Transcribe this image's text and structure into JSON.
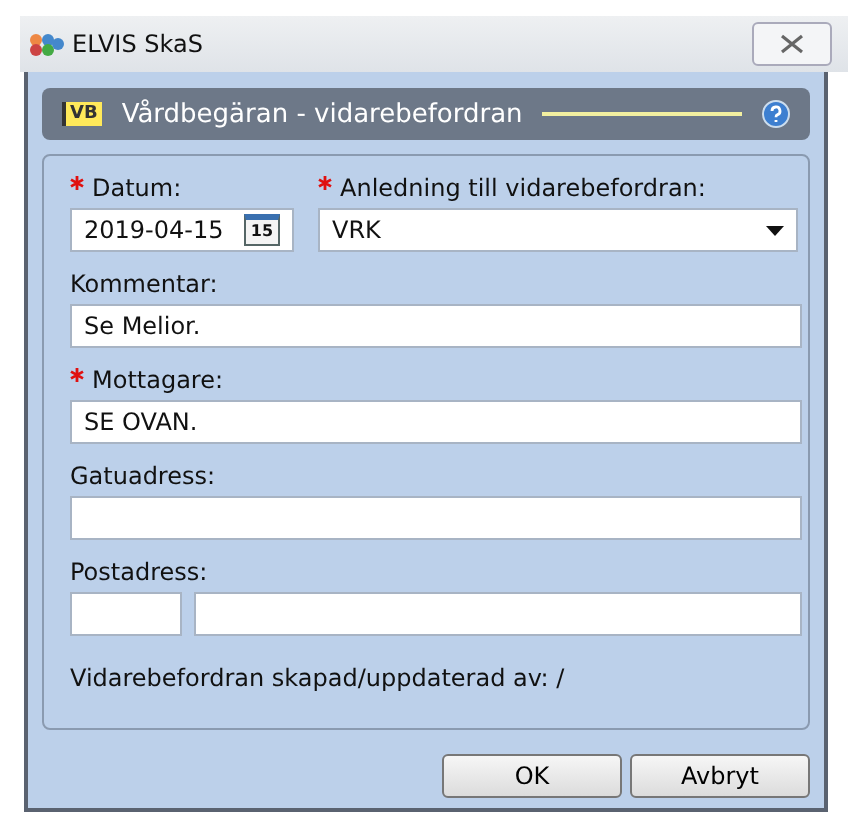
{
  "window": {
    "title": "ELVIS SkaS"
  },
  "header": {
    "badge": "VB",
    "title": "Vårdbegäran - vidarebefordran"
  },
  "fields": [
    {
      "kind": "date",
      "label": "Datum:",
      "required": true,
      "value": "2019-04-15",
      "calendar_day": "15"
    },
    {
      "kind": "select",
      "label": "Anledning till vidarebefordran:",
      "required": true,
      "value": "VRK"
    },
    {
      "kind": "text",
      "label": "Kommentar:",
      "required": false,
      "value": "Se Melior."
    },
    {
      "kind": "text",
      "label": "Mottagare:",
      "required": true,
      "value": "SE OVAN."
    },
    {
      "kind": "text",
      "label": "Gatuadress:",
      "required": false
    },
    {
      "kind": "split",
      "label": "Postadress:",
      "required": false
    }
  ],
  "footer_note": "Vidarebefordran skapad/uppdaterad av: /",
  "buttons": [
    "OK",
    "Avbryt"
  ]
}
